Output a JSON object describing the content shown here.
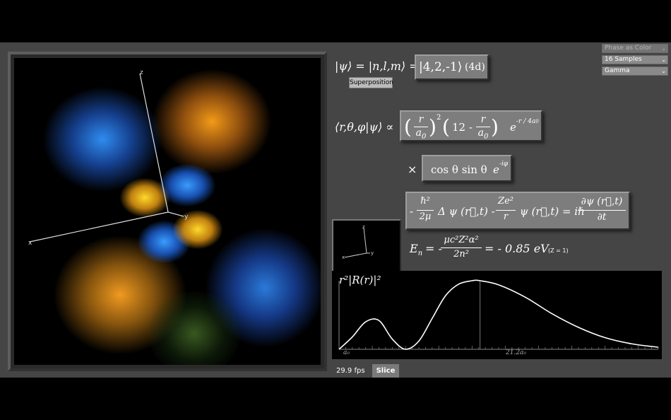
{
  "controls": {
    "phase_color": "Phase as Color",
    "samples": "16 Samples",
    "gamma": "Gamma"
  },
  "state": {
    "ket_lhs": "|ψ⟩ = |n,l,m⟩ =",
    "ket_value": "|4,2,-1⟩",
    "ket_label": "(4d)",
    "superposition_button": "Superposition"
  },
  "wavefunction": {
    "lhs": "⟨r,θ,φ|ψ⟩ ∝",
    "r_over_a0": {
      "num": "r",
      "den": "a",
      "den_sub": "0",
      "power": "2"
    },
    "poly": "12 -",
    "exp": "e",
    "exp_power": "-r / 4a",
    "exp_power_sub": "0",
    "times": "×",
    "angular": "cos θ  sin θ",
    "angular_exp": "e",
    "angular_exp_power": "-iφ"
  },
  "schrodinger": {
    "minus": "-",
    "hbar_num": "ℏ²",
    "mu_den": "2μ",
    "laplace": "Δ ψ (r⃗,t) -",
    "Ze_num": "Ze²",
    "r_den": "r",
    "psi_eq": "ψ (r⃗,t) = iℏ",
    "dpsi_num": "∂ψ (r⃗,t)",
    "dt_den": "∂t"
  },
  "energy": {
    "lhs": "E",
    "lhs_sub": "n",
    "eq_minus": "= -",
    "num": "μc²Z²α²",
    "den": "2n²",
    "result": "= - 0.85 eV",
    "note": "(Z = 1)"
  },
  "axes_labels": {
    "x": "x",
    "y": "y",
    "z": "z"
  },
  "chart_data": {
    "type": "line",
    "title": "r²|R(r)|²",
    "x_start_label": "a₀",
    "peak_label": "21.2a₀",
    "x": [
      0,
      2,
      4,
      6,
      8,
      10,
      12,
      14,
      16,
      18,
      20,
      21.2,
      24,
      28,
      32,
      36,
      40,
      44,
      48
    ],
    "values": [
      0,
      0.18,
      0.4,
      0.42,
      0.15,
      0.0,
      0.12,
      0.45,
      0.78,
      0.95,
      1.0,
      1.0,
      0.94,
      0.76,
      0.52,
      0.32,
      0.17,
      0.08,
      0.03
    ]
  },
  "status": {
    "fps": "29.9 fps",
    "slice_button": "Slice"
  }
}
